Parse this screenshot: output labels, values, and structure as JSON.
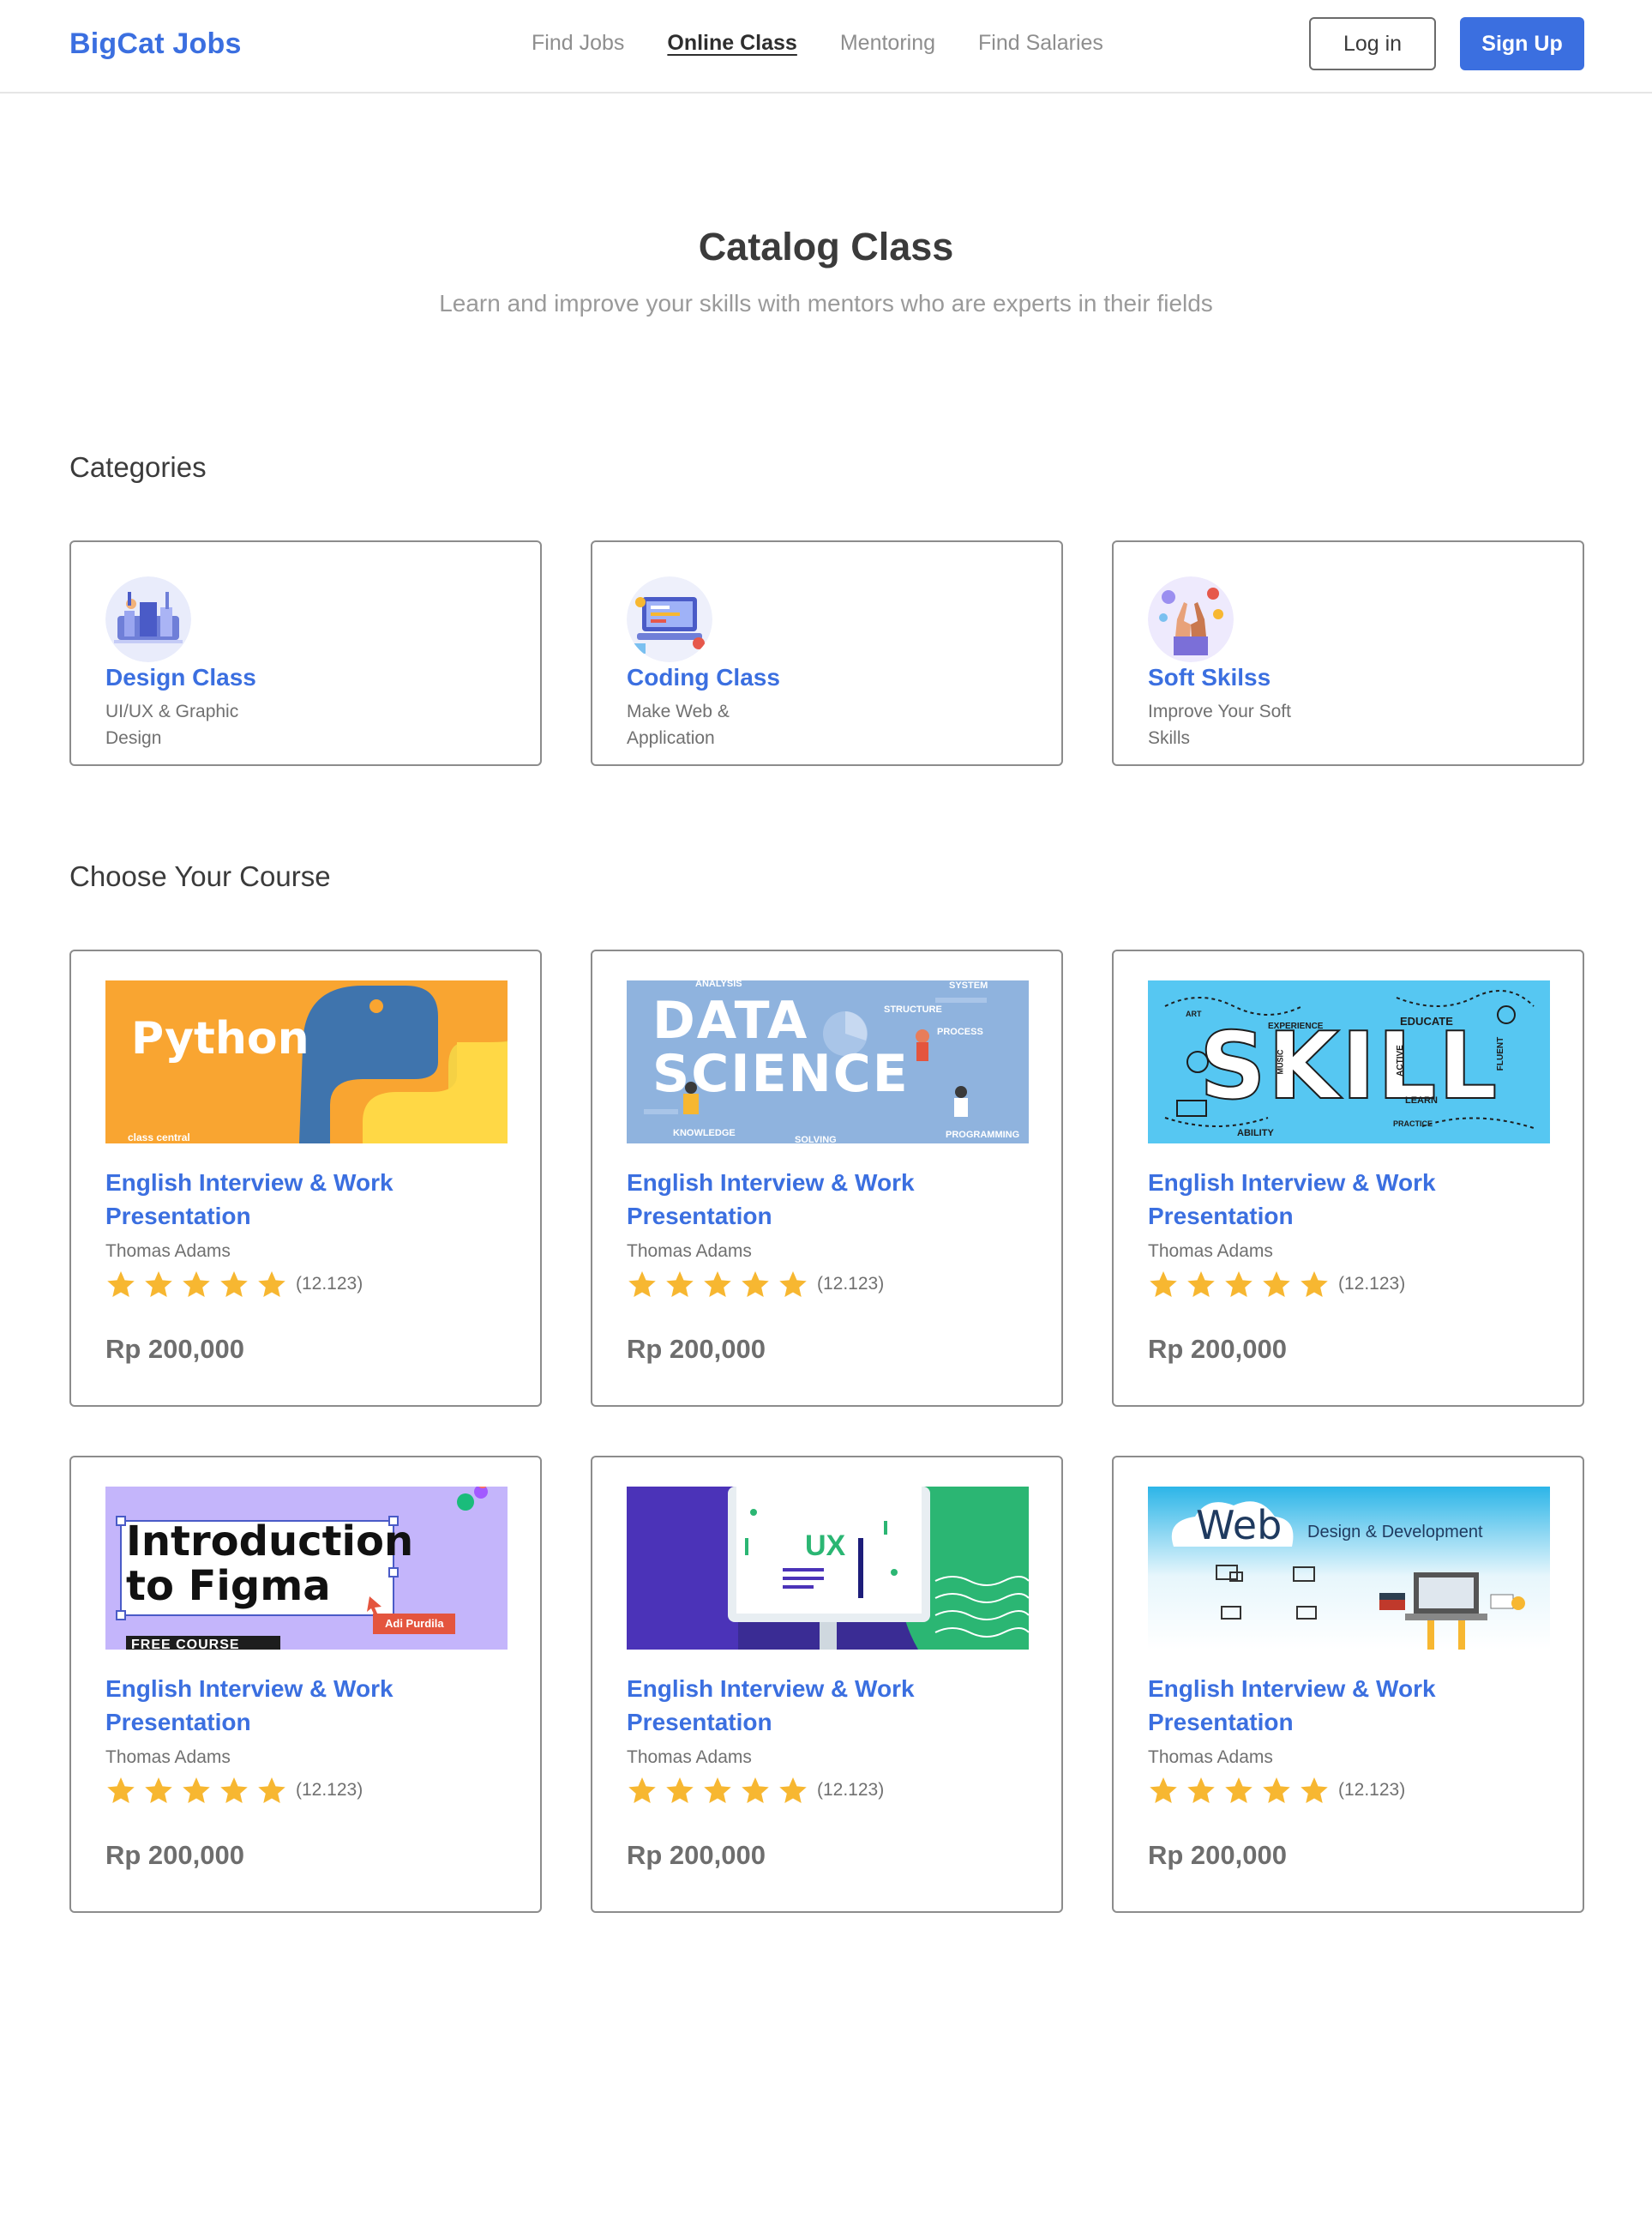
{
  "header": {
    "brand": "BigCat Jobs",
    "nav": [
      "Find Jobs",
      "Online Class",
      "Mentoring",
      "Find Salaries"
    ],
    "active_nav": "Online Class",
    "login_label": "Log in",
    "signup_label": "Sign Up"
  },
  "hero": {
    "title": "Catalog Class",
    "subtitle": "Learn and improve your skills with mentors who are experts in their fields"
  },
  "categories": {
    "heading": "Categories",
    "items": [
      {
        "title": "Design Class",
        "desc": "UI/UX & Graphic Design",
        "icon": "design-illustration-icon"
      },
      {
        "title": "Coding Class",
        "desc": "Make Web & Application",
        "icon": "coding-illustration-icon"
      },
      {
        "title": "Soft Skilss",
        "desc": "Improve Your Soft Skills",
        "icon": "soft-skills-illustration-icon"
      }
    ]
  },
  "courses": {
    "heading": "Choose Your Course",
    "items": [
      {
        "thumb_text": "Python",
        "thumb_subtext": "class central",
        "title": "English Interview & Work Presentation",
        "author": "Thomas Adams",
        "rating_count": "(12.123)",
        "price": "Rp 200,000",
        "stars": 5
      },
      {
        "thumb_text": "DATA SCIENCE",
        "thumb_words": [
          "ANALYSIS",
          "STRUCTURE",
          "PROCESS",
          "SYSTEM",
          "KNOWLEDGE",
          "SOLVING",
          "PROGRAMMING"
        ],
        "title": "English Interview & Work Presentation",
        "author": "Thomas Adams",
        "rating_count": "(12.123)",
        "price": "Rp 200,000",
        "stars": 5
      },
      {
        "thumb_text": "SKILL",
        "thumb_words": [
          "ART",
          "EXPERIENCE",
          "EDUCATE",
          "MUSIC",
          "ACTIVE",
          "FLUENT",
          "LEARN",
          "ABILITY",
          "PRACTICE"
        ],
        "title": "English Interview & Work Presentation",
        "author": "Thomas Adams",
        "rating_count": "(12.123)",
        "price": "Rp 200,000",
        "stars": 5
      },
      {
        "thumb_text": "Introduction to Figma",
        "thumb_badge": "Adi Purdila",
        "thumb_footer": "FREE COURSE",
        "title": "English Interview & Work Presentation",
        "author": "Thomas Adams",
        "rating_count": "(12.123)",
        "price": "Rp 200,000",
        "stars": 5
      },
      {
        "thumb_text": "UX",
        "title": "English Interview & Work Presentation",
        "author": "Thomas Adams",
        "rating_count": "(12.123)",
        "price": "Rp 200,000",
        "stars": 5
      },
      {
        "thumb_text": "Web",
        "thumb_subtext": "Design & Development",
        "title": "English Interview & Work Presentation",
        "author": "Thomas Adams",
        "rating_count": "(12.123)",
        "price": "Rp 200,000",
        "stars": 5
      }
    ]
  },
  "colors": {
    "accent": "#3b6fe0",
    "star": "#f7b731",
    "border": "#8c8c8c"
  }
}
